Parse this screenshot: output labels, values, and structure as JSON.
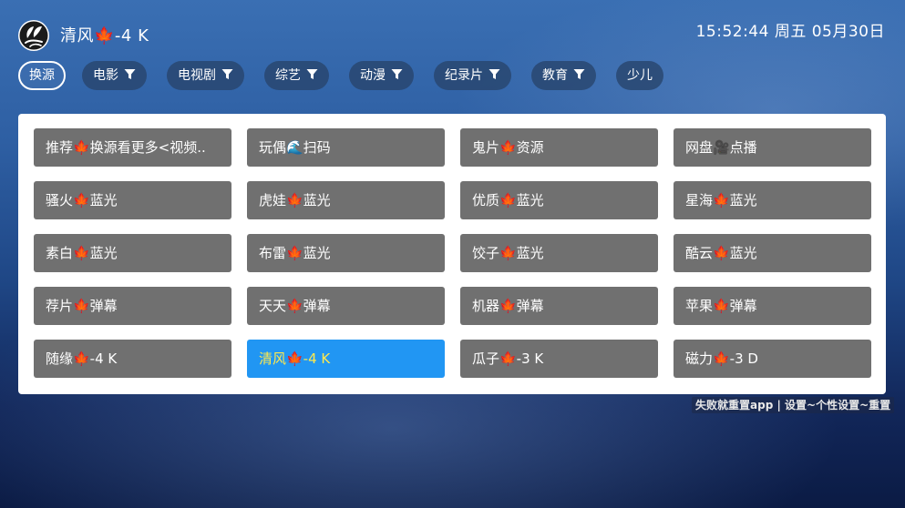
{
  "header": {
    "logo_icon": "tvbox-leaf-logo-icon",
    "title": "清风🍁-4 K",
    "clock": "15:52:44 周五 05月30日"
  },
  "filters": [
    {
      "label": "换源",
      "filter": false,
      "active": true
    },
    {
      "label": "电影",
      "filter": true
    },
    {
      "label": "电视剧",
      "filter": true
    },
    {
      "label": "综艺",
      "filter": true
    },
    {
      "label": "动漫",
      "filter": true
    },
    {
      "label": "纪录片",
      "filter": true
    },
    {
      "label": "教育",
      "filter": true
    },
    {
      "label": "少儿",
      "filter": false
    }
  ],
  "sources": [
    {
      "label": "推荐🍁换源看更多<视频.."
    },
    {
      "label": "玩偶🌊扫码"
    },
    {
      "label": "鬼片🍁资源"
    },
    {
      "label": "网盘🎥点播"
    },
    {
      "label": "骚火🍁蓝光"
    },
    {
      "label": "虎娃🍁蓝光"
    },
    {
      "label": "优质🍁蓝光"
    },
    {
      "label": "星海🍁蓝光"
    },
    {
      "label": "素白🍁蓝光"
    },
    {
      "label": "布雷🍁蓝光"
    },
    {
      "label": "饺子🍁蓝光"
    },
    {
      "label": "酷云🍁蓝光"
    },
    {
      "label": "荐片🍁弹幕"
    },
    {
      "label": "天天🍁弹幕"
    },
    {
      "label": "机器🍁弹幕"
    },
    {
      "label": "苹果🍁弹幕"
    },
    {
      "label": "随缘🍁-4 K"
    },
    {
      "label": "清风🍁-4 K",
      "selected": true
    },
    {
      "label": "瓜子🍁-3 K"
    },
    {
      "label": "磁力🍁-3 D"
    }
  ],
  "hint": "失败就重置app | 设置~个性设置~重置",
  "colors": {
    "selected_bg": "#2196f3",
    "selected_text": "#ffe94d",
    "source_bg": "#707070"
  }
}
